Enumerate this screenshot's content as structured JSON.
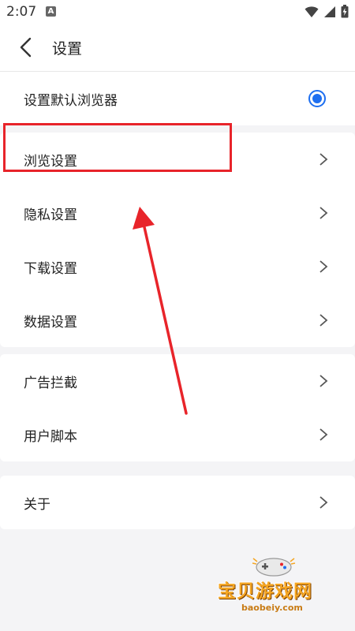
{
  "status_bar": {
    "time": "2:07",
    "badge": "A"
  },
  "header": {
    "title": "设置"
  },
  "sections": [
    {
      "items": [
        {
          "label": "设置默认浏览器",
          "control": "radio",
          "checked": true
        }
      ]
    },
    {
      "items": [
        {
          "label": "浏览设置",
          "control": "chevron"
        },
        {
          "label": "隐私设置",
          "control": "chevron"
        },
        {
          "label": "下载设置",
          "control": "chevron"
        },
        {
          "label": "数据设置",
          "control": "chevron"
        }
      ]
    },
    {
      "items": [
        {
          "label": "广告拦截",
          "control": "chevron"
        },
        {
          "label": "用户脚本",
          "control": "chevron"
        }
      ]
    },
    {
      "items": [
        {
          "label": "关于",
          "control": "chevron"
        }
      ]
    }
  ],
  "annotation": {
    "highlight_color": "#e8242a",
    "highlight_target": "浏览设置"
  },
  "watermark": {
    "text": "宝贝游戏网",
    "url": "baobeiy.com"
  },
  "colors": {
    "accent": "#1e6ff0",
    "background": "#f4f4f6"
  }
}
